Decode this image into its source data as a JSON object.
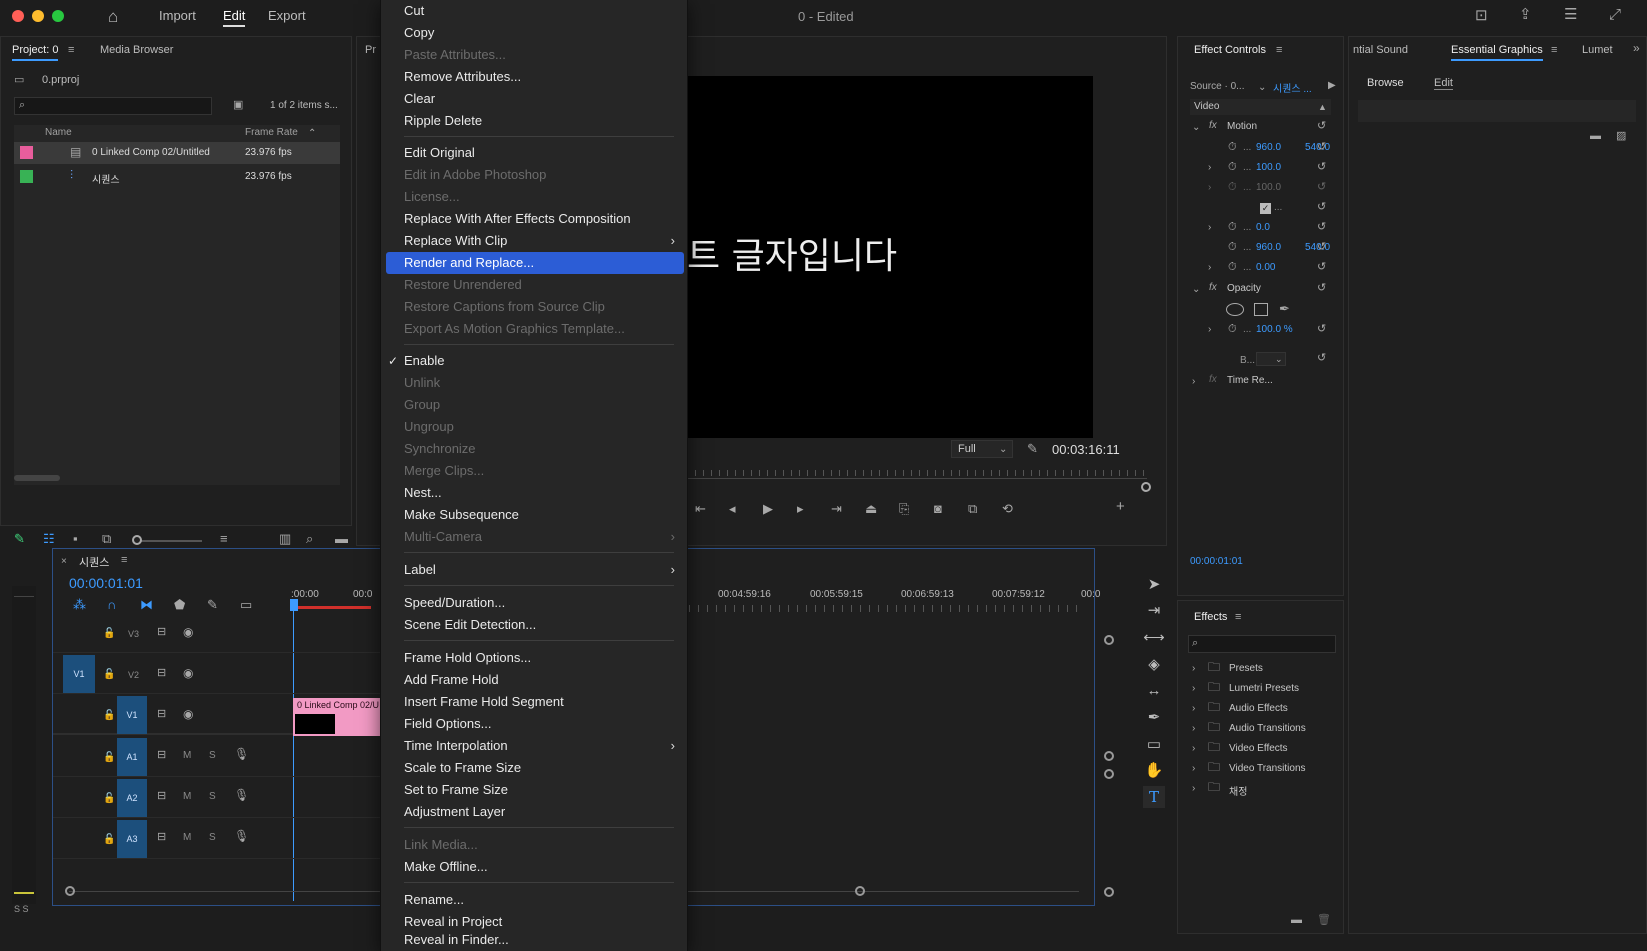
{
  "titlebar": {
    "nav": [
      "Import",
      "Edit",
      "Export"
    ],
    "title": "0 - Edited"
  },
  "project": {
    "tab": "Project: 0",
    "media_browser": "Media Browser",
    "file": "0.prproj",
    "count": "1 of 2 items s...",
    "col_name": "Name",
    "col_fps": "Frame Rate",
    "items": [
      {
        "name": "0 Linked Comp 02/Untitled",
        "fps": "23.976 fps",
        "color": "#e85d9c"
      },
      {
        "name": "시퀀스",
        "fps": "23.976 fps",
        "color": "#38b255"
      }
    ]
  },
  "program": {
    "tab": "Pr",
    "overlay_text": "트 글자입니다",
    "quality": "Full",
    "timecode": "00:03:16:11"
  },
  "timeline": {
    "tab": "시퀀스",
    "timecode": "00:00:01:01",
    "ruler_left": [
      ":00:00",
      "00:0"
    ],
    "ruler": [
      "00:04:59:16",
      "00:05:59:15",
      "00:06:59:13",
      "00:07:59:12",
      "00:0"
    ],
    "tracks": [
      {
        "src": "",
        "name": "V3"
      },
      {
        "src": "V1",
        "name": "V2"
      },
      {
        "src": "",
        "name": "V1"
      },
      {
        "src": "",
        "name": "A1"
      },
      {
        "src": "",
        "name": "A2"
      },
      {
        "src": "",
        "name": "A3"
      }
    ],
    "clip_label": "0 Linked Comp 02/U",
    "ms": [
      "M",
      "S"
    ],
    "meter": "S S"
  },
  "effect_controls": {
    "tab": "Effect Controls",
    "source": "Source · 0...",
    "seq": "시퀀스 ...",
    "section": "Video",
    "motion": "Motion",
    "rows": [
      {
        "v1": "960.0",
        "v2": "540.0"
      },
      {
        "v1": "100.0",
        "v2": ""
      },
      {
        "v1": "100.0",
        "v2": ""
      },
      {
        "v1": "",
        "v2": ""
      },
      {
        "v1": "0.0",
        "v2": ""
      },
      {
        "v1": "960.0",
        "v2": "540.0"
      },
      {
        "v1": "0.00",
        "v2": ""
      }
    ],
    "opacity": "Opacity",
    "opacity_val": "100.0 %",
    "blend": "B...",
    "time_remap": "Time Re...",
    "timecode": "00:00:01:01",
    "ellipsis": "..."
  },
  "right_tabs": {
    "t1": "ntial Sound",
    "t2": "Essential Graphics",
    "t3": "Lumet",
    "browse": "Browse",
    "edit": "Edit"
  },
  "effects": {
    "tab": "Effects",
    "folders": [
      "Presets",
      "Lumetri Presets",
      "Audio Effects",
      "Audio Transitions",
      "Video Effects",
      "Video Transitions",
      "채정"
    ]
  },
  "menu": [
    {
      "label": "Cut",
      "state": "en"
    },
    {
      "label": "Copy",
      "state": "en"
    },
    {
      "label": "Paste Attributes...",
      "state": "dis"
    },
    {
      "label": "Remove Attributes...",
      "state": "en"
    },
    {
      "label": "Clear",
      "state": "en"
    },
    {
      "label": "Ripple Delete",
      "state": "en"
    },
    {
      "label": "Edit Original",
      "state": "en"
    },
    {
      "label": "Edit in Adobe Photoshop",
      "state": "dis"
    },
    {
      "label": "License...",
      "state": "dis"
    },
    {
      "label": "Replace With After Effects Composition",
      "state": "en"
    },
    {
      "label": "Replace With Clip",
      "state": "en"
    },
    {
      "label": "Render and Replace...",
      "state": "hl"
    },
    {
      "label": "Restore Unrendered",
      "state": "dis"
    },
    {
      "label": "Restore Captions from Source Clip",
      "state": "dis"
    },
    {
      "label": "Export As Motion Graphics Template...",
      "state": "dis"
    },
    {
      "label": "Enable",
      "state": "en"
    },
    {
      "label": "Unlink",
      "state": "dis"
    },
    {
      "label": "Group",
      "state": "dis"
    },
    {
      "label": "Ungroup",
      "state": "dis"
    },
    {
      "label": "Synchronize",
      "state": "dis"
    },
    {
      "label": "Merge Clips...",
      "state": "dis"
    },
    {
      "label": "Nest...",
      "state": "en"
    },
    {
      "label": "Make Subsequence",
      "state": "en"
    },
    {
      "label": "Multi-Camera",
      "state": "dis"
    },
    {
      "label": "Label",
      "state": "en"
    },
    {
      "label": "Speed/Duration...",
      "state": "en"
    },
    {
      "label": "Scene Edit Detection...",
      "state": "en"
    },
    {
      "label": "Frame Hold Options...",
      "state": "en"
    },
    {
      "label": "Add Frame Hold",
      "state": "en"
    },
    {
      "label": "Insert Frame Hold Segment",
      "state": "en"
    },
    {
      "label": "Field Options...",
      "state": "en"
    },
    {
      "label": "Time Interpolation",
      "state": "en"
    },
    {
      "label": "Scale to Frame Size",
      "state": "en"
    },
    {
      "label": "Set to Frame Size",
      "state": "en"
    },
    {
      "label": "Adjustment Layer",
      "state": "en"
    },
    {
      "label": "Link Media...",
      "state": "dis"
    },
    {
      "label": "Make Offline...",
      "state": "en"
    },
    {
      "label": "Rename...",
      "state": "en"
    },
    {
      "label": "Reveal in Project",
      "state": "en"
    },
    {
      "label": "Reveal in Finder...",
      "state": "en"
    }
  ],
  "icons": {
    "check": "✓",
    "submenu": "›"
  }
}
